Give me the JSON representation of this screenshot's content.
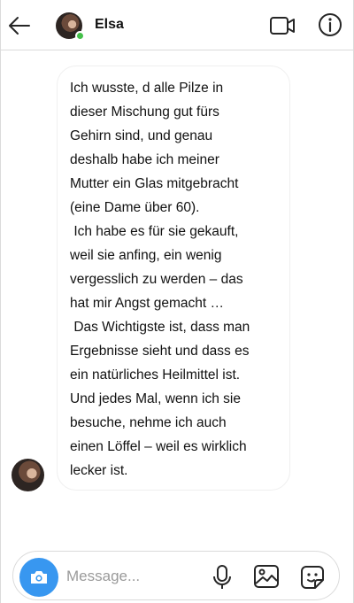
{
  "header": {
    "back_icon": "arrow-left-icon",
    "contact_name": "Elsa",
    "online": true,
    "video_icon": "video-camera-icon",
    "info_icon": "info-icon"
  },
  "messages": [
    {
      "sender": "Elsa",
      "text": "Ich wusste, d alle Pilze in\ndieser Mischung gut fürs\nGehirn sind, und genau\ndeshalb habe ich meiner\nMutter ein Glas mitgebracht\n(eine Dame über 60).\n Ich habe es für sie gekauft,\nweil sie anfing, ein wenig\nvergesslich zu werden – das\nhat mir Angst gemacht …\n Das Wichtigste ist, dass man\nErgebnisse sieht und dass es\nein natürliches Heilmittel ist.\nUnd jedes Mal, wenn ich sie\nbesuche, nehme ich auch\neinen Löffel – weil es wirklich\nlecker ist."
    }
  ],
  "composer": {
    "placeholder": "Message...",
    "value": "",
    "camera_icon": "camera-icon",
    "mic_icon": "microphone-icon",
    "gallery_icon": "image-icon",
    "sticker_icon": "sticker-icon"
  },
  "colors": {
    "accent": "#3897f0",
    "online": "#44c04a",
    "border": "#dbdbdb"
  }
}
